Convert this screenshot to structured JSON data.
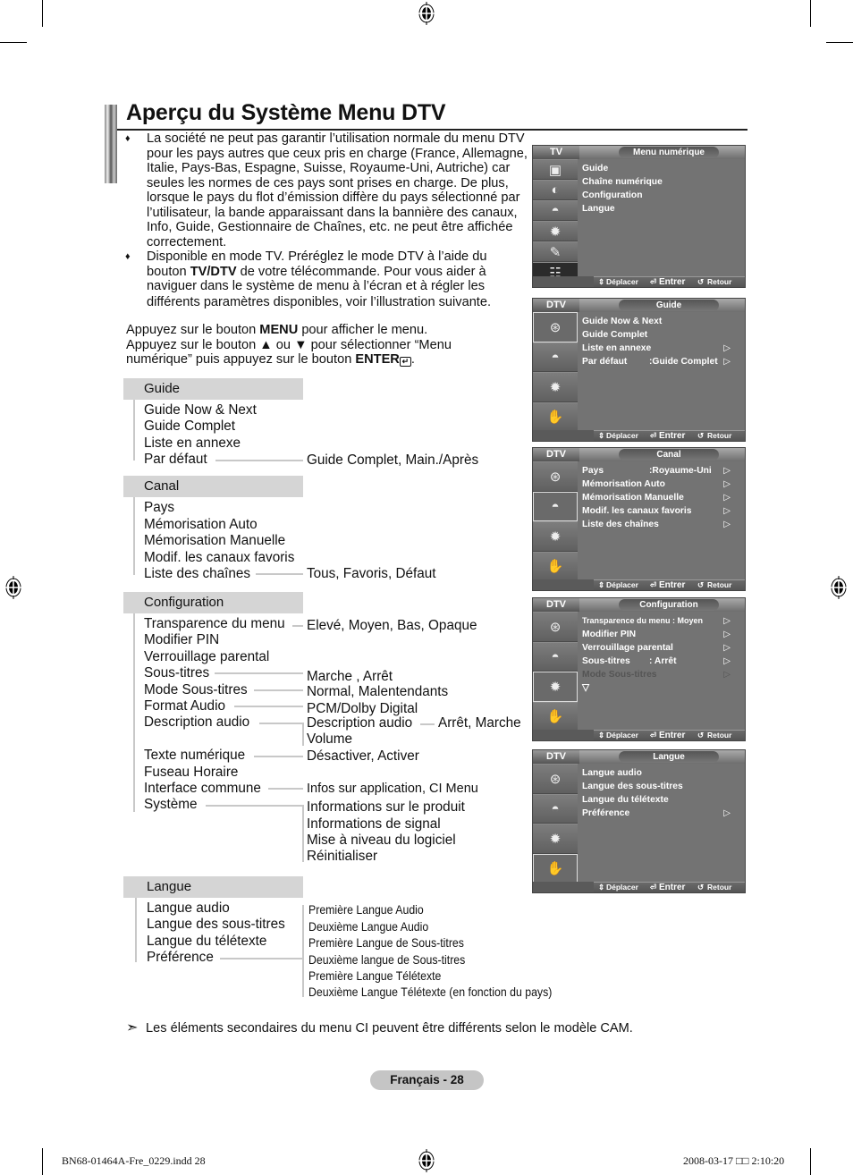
{
  "title": "Aperçu du Système Menu DTV",
  "bullets": [
    "La société ne peut pas garantir l’utilisation normale du menu DTV pour les pays autres que ceux pris en charge (France, Allemagne, Italie, Pays-Bas, Espagne, Suisse, Royaume-Uni, Autriche) car seules les normes de ces pays sont prises en charge.  De plus, lorsque le pays du flot d’émission diffère du pays sélectionné par l’utilisateur, la bande apparaissant dans la bannière des canaux, Info, Guide, Gestionnaire de Chaînes, etc. ne peut être affichée correctement.",
    {
      "pre": "Disponible en mode TV. Préréglez le mode DTV à l’aide du bouton ",
      "bold": "TV/DTV",
      "post": " de votre télécommande. Pour vous aider à naviguer dans le système de menu à l’écran et à régler les",
      "last": "différents paramètres disponibles, voir l’illustration suivante."
    }
  ],
  "instructions": {
    "l1_pre": "Appuyez sur le bouton ",
    "l1_bold": "MENU",
    "l1_post": " pour afficher le menu.",
    "l2": "Appuyez sur le bouton ▲ ou ▼ pour sélectionner “Menu",
    "l3_pre": "numérique” puis appuyez sur le bouton ",
    "l3_bold": "ENTER",
    "l3_post": "."
  },
  "tree": {
    "guide": {
      "label": "Guide",
      "items": [
        "Guide Now & Next",
        "Guide Complet",
        "Liste en annexe",
        "Par défaut"
      ],
      "par_defaut_options": "Guide Complet, Main./Après"
    },
    "canal": {
      "label": "Canal",
      "items": [
        "Pays",
        "Mémorisation Auto",
        "Mémorisation Manuelle",
        "Modif. les canaux favoris",
        "Liste des chaînes"
      ],
      "liste_options": "Tous, Favoris, Défaut"
    },
    "configuration": {
      "label": "Configuration",
      "items": [
        "Transparence du menu",
        "Modifier PIN",
        "Verrouillage parental",
        "Sous-titres",
        "Mode Sous-titres",
        "Format Audio",
        "Description audio",
        "Texte numérique",
        "Fuseau Horaire",
        "Interface commune",
        "Système"
      ],
      "transparence_options": "Elevé, Moyen, Bas, Opaque",
      "sous_titres_options": "Marche , Arrêt",
      "mode_sous_titres_options": "Normal, Malentendants",
      "format_audio_options": "PCM/Dolby Digital",
      "description_audio_sub": [
        "Description audio",
        "Volume"
      ],
      "description_audio_values": "Arrêt, Marche",
      "texte_numerique_options": "Désactiver, Activer",
      "interface_commune_options": "Infos sur application, CI Menu",
      "systeme_options": [
        "Informations sur le produit",
        "Informations de signal",
        "Mise à niveau du logiciel",
        "Réinitialiser"
      ]
    },
    "langue": {
      "label": "Langue",
      "items": [
        "Langue audio",
        "Langue des sous-titres",
        "Langue du télétexte",
        "Préférence"
      ],
      "preference_options": [
        "Première Langue Audio",
        "Deuxième Langue Audio",
        "Première Langue de Sous-titres",
        "Deuxième langue de Sous-titres",
        "Première Langue Télétexte",
        "Deuxième Langue Télétexte (en fonction du pays)"
      ]
    }
  },
  "osd_footer": {
    "move": "Déplacer",
    "enter": "Entrer",
    "back": "Retour"
  },
  "screens": [
    {
      "mode": "TV",
      "title": "Menu numérique",
      "items": [
        {
          "label": "Guide"
        },
        {
          "label": "Chaîne numérique"
        },
        {
          "label": "Configuration"
        },
        {
          "label": "Langue"
        }
      ]
    },
    {
      "mode": "DTV",
      "title": "Guide",
      "items": [
        {
          "label": "Guide Now & Next"
        },
        {
          "label": "Guide Complet"
        },
        {
          "label": "Liste en annexe",
          "arrow": true
        },
        {
          "label": "Par défaut",
          "value": ":Guide Complet",
          "arrow": true
        }
      ]
    },
    {
      "mode": "DTV",
      "title": "Canal",
      "items": [
        {
          "label": "Pays",
          "value": ":Royaume-Uni",
          "arrow": true
        },
        {
          "label": "Mémorisation Auto",
          "arrow": true
        },
        {
          "label": "Mémorisation Manuelle",
          "arrow": true
        },
        {
          "label": "Modif. les canaux favoris",
          "arrow": true
        },
        {
          "label": "Liste des chaînes",
          "arrow": true
        }
      ]
    },
    {
      "mode": "DTV",
      "title": "Configuration",
      "items": [
        {
          "label": "Transparence du menu : Moyen",
          "arrow": true
        },
        {
          "label": "Modifier PIN",
          "arrow": true
        },
        {
          "label": "Verrouillage parental",
          "arrow": true
        },
        {
          "label": "Sous-titres",
          "value": ": Arrêt",
          "arrow": true
        },
        {
          "label": "Mode Sous-titres",
          "arrow": true,
          "disabled": true
        },
        {
          "label": "▽"
        }
      ]
    },
    {
      "mode": "DTV",
      "title": "Langue",
      "items": [
        {
          "label": "Langue audio"
        },
        {
          "label": "Langue des sous-titres"
        },
        {
          "label": "Langue du télétexte"
        },
        {
          "label": "Préférence",
          "arrow": true
        }
      ]
    }
  ],
  "note": "Les éléments secondaires du menu CI peuvent être différents selon le modèle CAM.",
  "page_label": "Français - 28",
  "footer": {
    "left": "BN68-01464A-Fre_0229.indd   28",
    "right": "2008-03-17   □□ 2:10:20"
  }
}
